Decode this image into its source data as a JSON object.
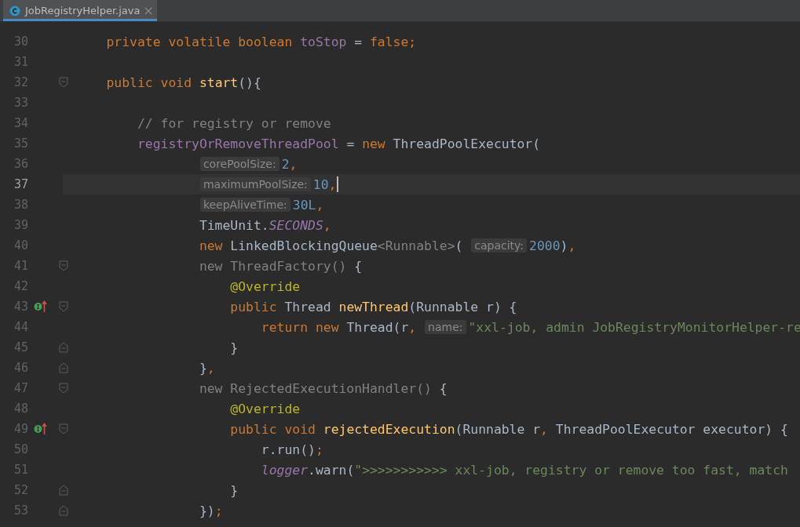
{
  "tabs": [
    {
      "label": "JobRegistryHelper.java",
      "selected": true
    }
  ],
  "lines": [
    {
      "number": "30",
      "current": false,
      "tokens": [
        {
          "kind": "keyword",
          "text": "    private volatile boolean "
        },
        {
          "kind": "field",
          "text": "toStop"
        },
        {
          "kind": "plain",
          "text": " = "
        },
        {
          "kind": "keyword",
          "text": "false;"
        }
      ]
    },
    {
      "number": "31",
      "current": false
    },
    {
      "number": "32",
      "current": false,
      "fold_start": true,
      "tokens": [
        {
          "kind": "keyword",
          "text": "    public void "
        },
        {
          "kind": "method",
          "text": "start"
        },
        {
          "kind": "plain",
          "text": "(){"
        }
      ]
    },
    {
      "number": "33",
      "current": false
    },
    {
      "number": "34",
      "current": false,
      "tokens": [
        {
          "kind": "comment",
          "text": "        // for registry or remove"
        }
      ]
    },
    {
      "number": "35",
      "current": false,
      "tokens": [
        {
          "kind": "field",
          "text": "        registryOrRemoveThreadPool"
        },
        {
          "kind": "plain",
          "text": " = "
        },
        {
          "kind": "keyword",
          "text": "new "
        },
        {
          "kind": "plain",
          "text": "ThreadPoolExecutor("
        }
      ]
    },
    {
      "number": "36",
      "current": false,
      "tokens": [
        {
          "kind": "hint",
          "text": "                corePoolSize:"
        },
        {
          "kind": "number",
          "text": "2"
        },
        {
          "kind": "keyword",
          "text": ","
        }
      ]
    },
    {
      "number": "37",
      "current": true,
      "tokens": [
        {
          "kind": "hint",
          "text": "                maximumPoolSize:"
        },
        {
          "kind": "number",
          "text": "10"
        },
        {
          "kind": "keyword",
          "text": ","
        }
      ]
    },
    {
      "number": "38",
      "current": false,
      "tokens": [
        {
          "kind": "hint",
          "text": "                keepAliveTime:"
        },
        {
          "kind": "number",
          "text": "30L"
        },
        {
          "kind": "keyword",
          "text": ","
        }
      ]
    },
    {
      "number": "39",
      "current": false,
      "tokens": [
        {
          "kind": "plain",
          "text": "                TimeUnit."
        },
        {
          "kind": "constant",
          "text": "SECONDS"
        },
        {
          "kind": "keyword",
          "text": ","
        }
      ]
    },
    {
      "number": "40",
      "current": false,
      "tokens": [
        {
          "kind": "keyword",
          "text": "                new "
        },
        {
          "kind": "plain",
          "text": "LinkedBlockingQueue"
        },
        {
          "kind": "dim",
          "text": "<Runnable>"
        },
        {
          "kind": "plain",
          "text": "("
        },
        {
          "kind": "hint",
          "text": "capacity:"
        },
        {
          "kind": "number",
          "text": "2000"
        },
        {
          "kind": "plain",
          "text": ")"
        },
        {
          "kind": "keyword",
          "text": ","
        }
      ]
    },
    {
      "number": "41",
      "current": false,
      "fold_start": true,
      "tokens": [
        {
          "kind": "dim",
          "text": "                new ThreadFactory() "
        },
        {
          "kind": "plain",
          "text": "{"
        }
      ]
    },
    {
      "number": "42",
      "current": false,
      "tokens": [
        {
          "kind": "annotation",
          "text": "                    @Override"
        }
      ]
    },
    {
      "number": "43",
      "current": false,
      "fold_start": true,
      "implements": true,
      "tokens": [
        {
          "kind": "keyword",
          "text": "                    public "
        },
        {
          "kind": "plain",
          "text": "Thread "
        },
        {
          "kind": "method",
          "text": "newThread"
        },
        {
          "kind": "plain",
          "text": "(Runnable r) {"
        }
      ]
    },
    {
      "number": "44",
      "current": false,
      "tokens": [
        {
          "kind": "keyword",
          "text": "                        return new "
        },
        {
          "kind": "plain",
          "text": "Thread(r"
        },
        {
          "kind": "keyword",
          "text": ","
        },
        {
          "kind": "hint",
          "text": "name:"
        },
        {
          "kind": "string",
          "text": "\"xxl-job, admin JobRegistryMonitorHelper-re"
        }
      ]
    },
    {
      "number": "45",
      "current": false,
      "fold_end": true,
      "tokens": [
        {
          "kind": "plain",
          "text": "                    }"
        }
      ]
    },
    {
      "number": "46",
      "current": false,
      "fold_end": true,
      "tokens": [
        {
          "kind": "plain",
          "text": "                }"
        },
        {
          "kind": "keyword",
          "text": ","
        }
      ]
    },
    {
      "number": "47",
      "current": false,
      "fold_start": true,
      "tokens": [
        {
          "kind": "dim",
          "text": "                new RejectedExecutionHandler() "
        },
        {
          "kind": "plain",
          "text": "{"
        }
      ]
    },
    {
      "number": "48",
      "current": false,
      "tokens": [
        {
          "kind": "annotation",
          "text": "                    @Override"
        }
      ]
    },
    {
      "number": "49",
      "current": false,
      "fold_start": true,
      "implements": true,
      "tokens": [
        {
          "kind": "keyword",
          "text": "                    public void "
        },
        {
          "kind": "method",
          "text": "rejectedExecution"
        },
        {
          "kind": "plain",
          "text": "(Runnable r"
        },
        {
          "kind": "keyword",
          "text": ", "
        },
        {
          "kind": "plain",
          "text": "ThreadPoolExecutor executor) {"
        }
      ]
    },
    {
      "number": "50",
      "current": false,
      "tokens": [
        {
          "kind": "plain",
          "text": "                        r.run()"
        },
        {
          "kind": "keyword",
          "text": ";"
        }
      ]
    },
    {
      "number": "51",
      "current": false,
      "tokens": [
        {
          "kind": "static",
          "text": "                        logger"
        },
        {
          "kind": "plain",
          "text": ".warn("
        },
        {
          "kind": "string",
          "text": "\">>>>>>>>>>> xxl-job, registry or remove too fast, match"
        }
      ]
    },
    {
      "number": "52",
      "current": false,
      "fold_end": true,
      "tokens": [
        {
          "kind": "plain",
          "text": "                    }"
        }
      ]
    },
    {
      "number": "53",
      "current": false,
      "fold_end": true,
      "tokens": [
        {
          "kind": "plain",
          "text": "                })"
        },
        {
          "kind": "keyword",
          "text": ";"
        }
      ]
    }
  ]
}
